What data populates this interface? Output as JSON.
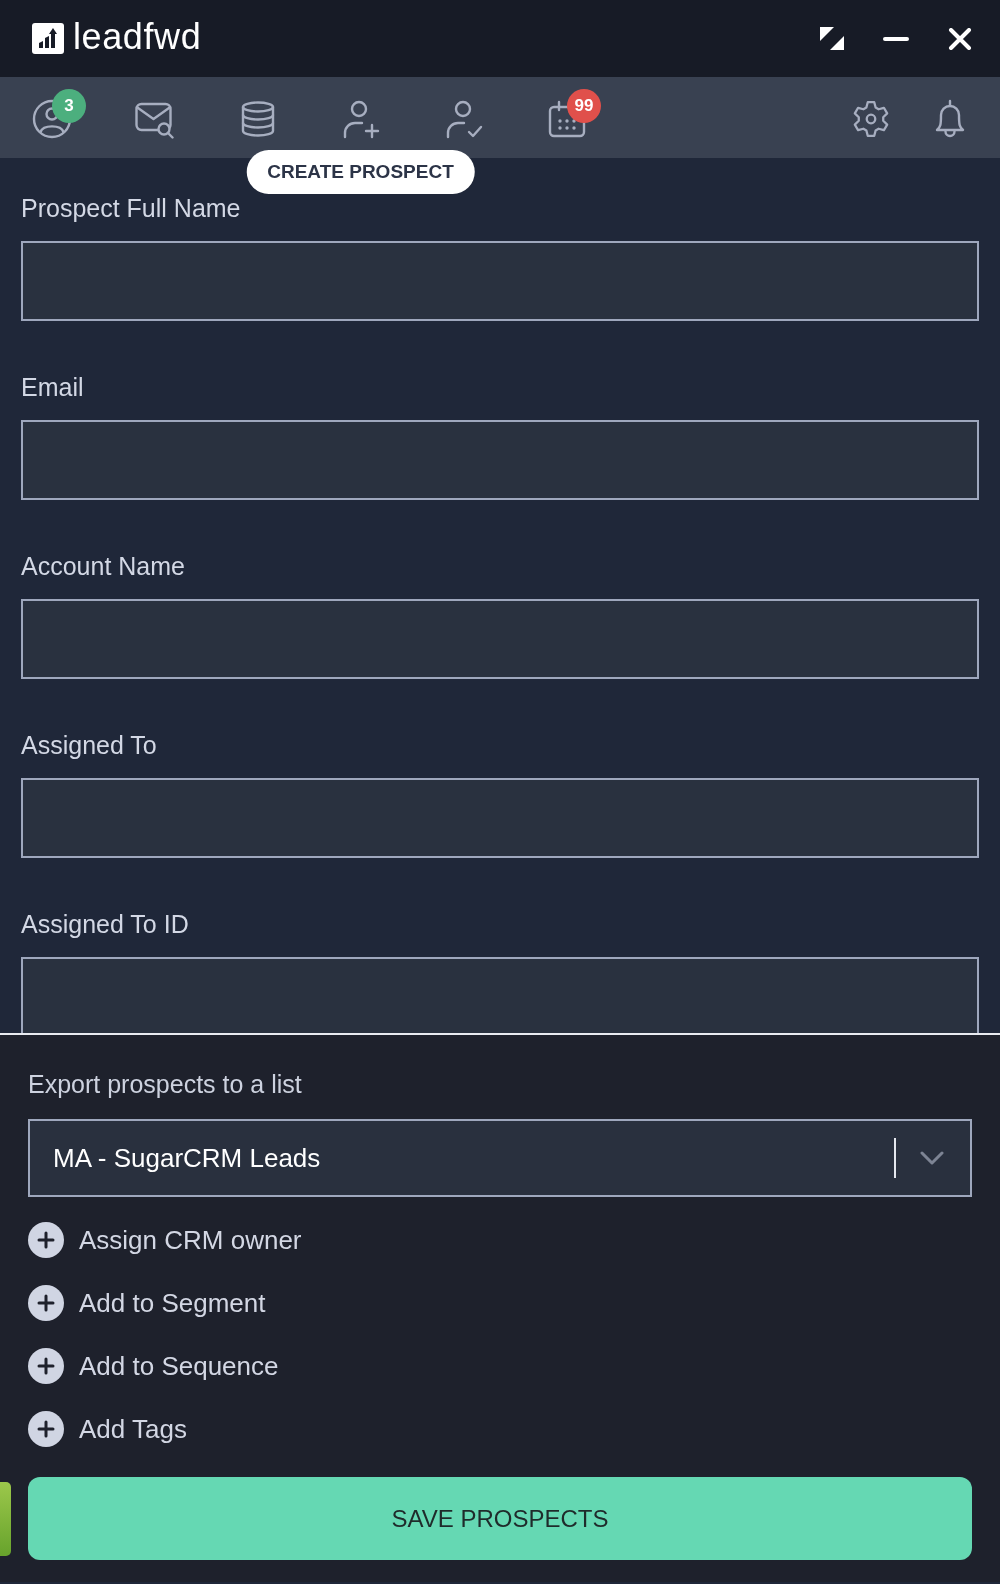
{
  "window": {
    "app_name": "leadfwd",
    "controls": [
      {
        "kind": "restore"
      },
      {
        "kind": "minimize"
      },
      {
        "kind": "close"
      }
    ]
  },
  "toolbar": {
    "left": [
      {
        "kind": "contacts",
        "badge": {
          "text": "3",
          "color": "#4caf7e"
        }
      },
      {
        "kind": "email-search"
      },
      {
        "kind": "database"
      },
      {
        "kind": "add-user",
        "tooltip": "CREATE PROSPECT"
      },
      {
        "kind": "user-check"
      },
      {
        "kind": "calendar",
        "badge": {
          "text": "99",
          "color": "#e0504b"
        }
      }
    ],
    "right": [
      {
        "kind": "settings"
      },
      {
        "kind": "notifications"
      }
    ]
  },
  "form": {
    "fields": [
      {
        "label": "Prospect Full Name"
      },
      {
        "label": "Email"
      },
      {
        "label": "Account Name"
      },
      {
        "label": "Assigned To"
      },
      {
        "label": "Assigned To ID"
      }
    ]
  },
  "export": {
    "label": "Export prospects to a list",
    "value": "MA - SugarCRM Leads"
  },
  "actions": [
    {
      "label": "Assign CRM owner"
    },
    {
      "label": "Add to Segment"
    },
    {
      "label": "Add to Sequence"
    },
    {
      "label": "Add Tags"
    }
  ],
  "save_button": {
    "label": "SAVE PROSPECTS"
  }
}
